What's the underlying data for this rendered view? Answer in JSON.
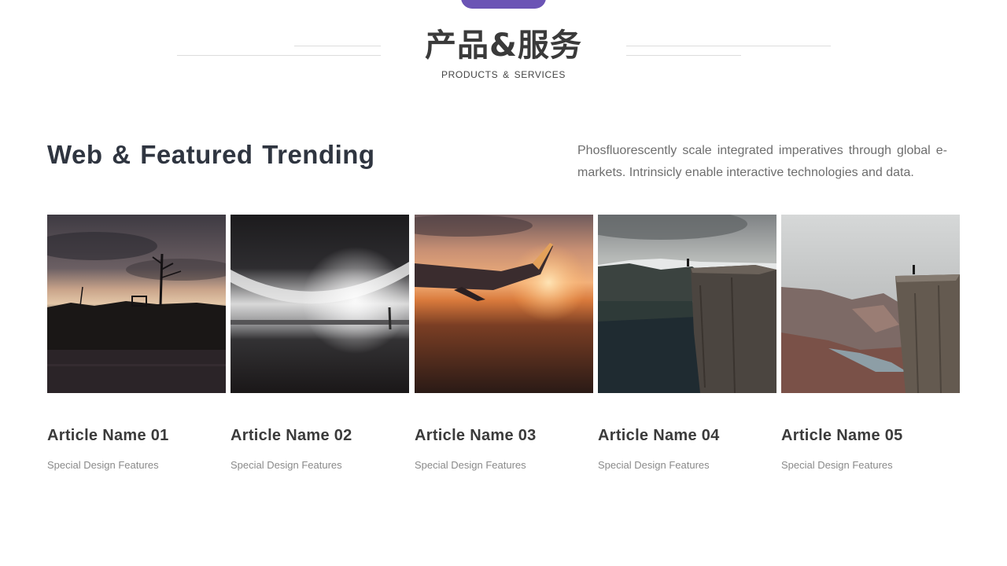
{
  "header": {
    "title_cn": "产品&服务",
    "title_en": "PRODUCTS & SERVICES"
  },
  "section": {
    "heading": "Web & Featured Trending",
    "description": "Phosfluorescently scale integrated imperatives through global e-markets. Intrinsicly enable interactive technologies and data."
  },
  "cards": [
    {
      "title": "Article Name 01",
      "subtitle": "Special Design Features"
    },
    {
      "title": "Article Name 02",
      "subtitle": "Special Design Features"
    },
    {
      "title": "Article Name 03",
      "subtitle": "Special Design Features"
    },
    {
      "title": "Article Name 04",
      "subtitle": "Special Design Features"
    },
    {
      "title": "Article Name 05",
      "subtitle": "Special Design Features"
    }
  ],
  "colors": {
    "accent": "#6b54b5",
    "heading": "#2f3540",
    "body_text": "#6e6e6e"
  }
}
